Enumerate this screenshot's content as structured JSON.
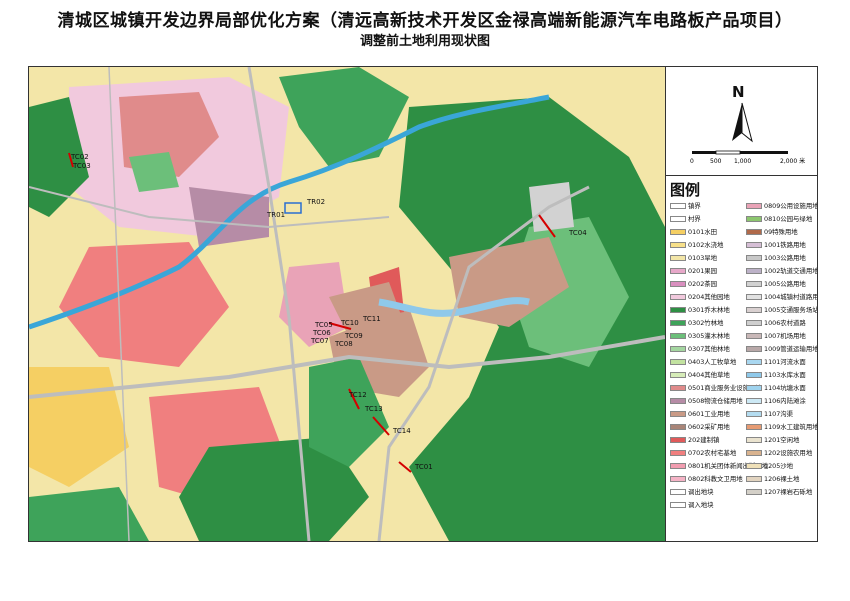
{
  "title": "清城区城镇开发边界局部优化方案（清远高新技术开发区金禄高端新能源汽车电路板产品项目）",
  "subtitle": "调整前土地利用现状图",
  "north_arrow": {
    "letter": "N"
  },
  "scale_bar": {
    "ticks": [
      "0",
      "500",
      "1,000",
      "2,000 米"
    ]
  },
  "legend": {
    "title": "图例",
    "left_column": [
      {
        "label": "镇界",
        "color": "#ffffff"
      },
      {
        "label": "村界",
        "color": "#ffffff"
      },
      {
        "label": "0101水田",
        "color": "#f5cf63"
      },
      {
        "label": "0102水浇地",
        "color": "#f7e08a"
      },
      {
        "label": "0103旱地",
        "color": "#f3e6a8"
      },
      {
        "label": "0201果园",
        "color": "#e7a8c9"
      },
      {
        "label": "0202茶园",
        "color": "#d98fbf"
      },
      {
        "label": "0204其他园地",
        "color": "#f1c9dd"
      },
      {
        "label": "0301乔木林地",
        "color": "#2e8f44"
      },
      {
        "label": "0302竹林地",
        "color": "#3ea35a"
      },
      {
        "label": "0305灌木林地",
        "color": "#6cbf7a"
      },
      {
        "label": "0307其他林地",
        "color": "#a4d6a0"
      },
      {
        "label": "0403人工牧草地",
        "color": "#c2e2a0"
      },
      {
        "label": "0404其他草地",
        "color": "#d6ecb8"
      },
      {
        "label": "0501商业服务业设施用地",
        "color": "#e08b8b"
      },
      {
        "label": "0508物流仓储用地",
        "color": "#b68ca6"
      },
      {
        "label": "0601工业用地",
        "color": "#c99a86"
      },
      {
        "label": "0602采矿用地",
        "color": "#a98578"
      },
      {
        "label": "202建制镇",
        "color": "#e05a5a"
      },
      {
        "label": "0702农村宅基地",
        "color": "#f07f7f"
      },
      {
        "label": "0801机关团体新闻出版用地",
        "color": "#f19db0"
      },
      {
        "label": "0802科教文卫用地",
        "color": "#f5b3c6"
      },
      {
        "label": "调出地块",
        "color": "#ffffff"
      },
      {
        "label": "调入地块",
        "color": "#ffffff"
      }
    ],
    "right_column": [
      {
        "label": "0809公用设施用地",
        "color": "#e9a3b7"
      },
      {
        "label": "0810公园与绿地",
        "color": "#8cc66e"
      },
      {
        "label": "09特殊用地",
        "color": "#b06a4a"
      },
      {
        "label": "1001铁路用地",
        "color": "#d6bfd6"
      },
      {
        "label": "1003公路用地",
        "color": "#c8c8c8"
      },
      {
        "label": "1002轨道交通用地",
        "color": "#bdb2c8"
      },
      {
        "label": "1005公路用地",
        "color": "#d2d2d2"
      },
      {
        "label": "1004城镇村道路用地",
        "color": "#e2e2e2"
      },
      {
        "label": "1005交通服务场站用地",
        "color": "#d9d0d0"
      },
      {
        "label": "1006农村道路",
        "color": "#cfcfcf"
      },
      {
        "label": "1007机场用地",
        "color": "#c9b8b8"
      },
      {
        "label": "1009管道运输用地",
        "color": "#b8a8a8"
      },
      {
        "label": "1101河流水面",
        "color": "#a9d7f0"
      },
      {
        "label": "1103水库水面",
        "color": "#8fc9ea"
      },
      {
        "label": "1104坑塘水面",
        "color": "#9fd3ee"
      },
      {
        "label": "1106内陆滩涂",
        "color": "#cde9f5"
      },
      {
        "label": "1107沟渠",
        "color": "#b4dcf0"
      },
      {
        "label": "1109水工建筑用地",
        "color": "#e69b73"
      },
      {
        "label": "1201空闲地",
        "color": "#eae3cf"
      },
      {
        "label": "1202设施农用地",
        "color": "#d9b38f"
      },
      {
        "label": "1205沙地",
        "color": "#efe0b8"
      },
      {
        "label": "1206裸土地",
        "color": "#e2d4c0"
      },
      {
        "label": "1207裸岩石砾地",
        "color": "#d4d0c8"
      }
    ]
  },
  "plot_labels": [
    {
      "id": "TC02"
    },
    {
      "id": "TC03"
    },
    {
      "id": "TR01"
    },
    {
      "id": "TR02"
    },
    {
      "id": "TC04"
    },
    {
      "id": "TC10"
    },
    {
      "id": "TC11"
    },
    {
      "id": "TC05"
    },
    {
      "id": "TC06"
    },
    {
      "id": "TC07"
    },
    {
      "id": "TC08"
    },
    {
      "id": "TC09"
    },
    {
      "id": "TC12"
    },
    {
      "id": "TC13"
    },
    {
      "id": "TC14"
    },
    {
      "id": "TC01"
    }
  ],
  "colors": {
    "boundary_out": "#d40000",
    "boundary_in": "#2a6fd1",
    "river": "#3aa6d8",
    "road": "#bdbdbd"
  }
}
